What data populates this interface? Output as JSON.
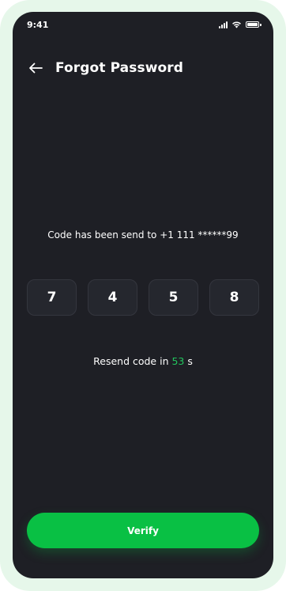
{
  "status_bar": {
    "time": "9:41"
  },
  "header": {
    "back_icon": "arrow-left-icon",
    "title": "Forgot Password"
  },
  "info": {
    "text": "Code has been send to +1 111 ******99"
  },
  "otp": {
    "digits": [
      "7",
      "4",
      "5",
      "8"
    ]
  },
  "resend": {
    "prefix": "Resend code in ",
    "count": "53",
    "suffix": " s"
  },
  "verify_button": {
    "label": "Verify"
  },
  "colors": {
    "background": "#1e1f25",
    "accent": "#09c044",
    "otp_box": "#25272e",
    "frame": "#e6f7ea"
  }
}
